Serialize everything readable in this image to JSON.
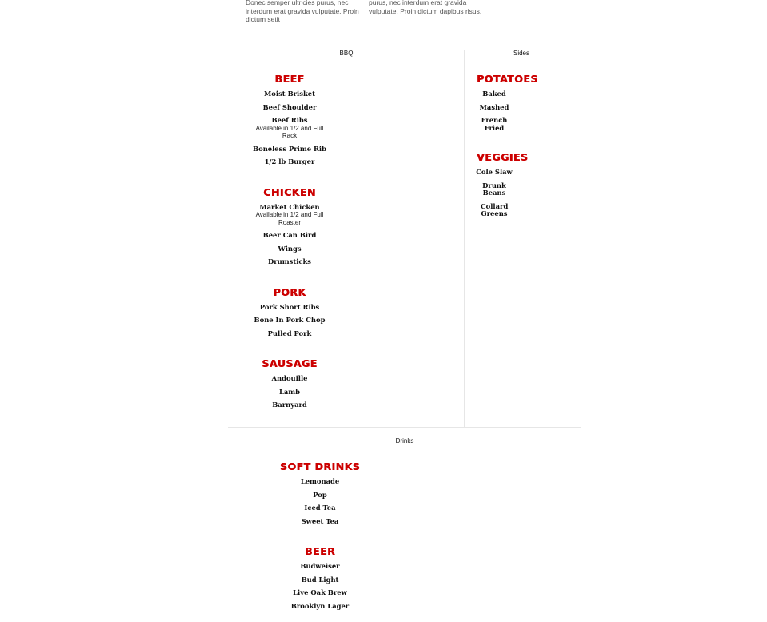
{
  "intro": {
    "left": "Donec semper ultricies purus, nec interdum erat gravida vulputate. Proin dictum setit",
    "right": "purus, nec interdum erat gravida vulputate. Proin dictum dapibus risus."
  },
  "sections": {
    "bbq": "BBQ",
    "sides": "Sides",
    "drinks": "Drinks"
  },
  "bbq": {
    "beef": {
      "title": "BEEF",
      "items": [
        {
          "name": "Moist Brisket"
        },
        {
          "name": "Beef Shoulder"
        },
        {
          "name": "Beef Ribs",
          "note": "Available in 1/2 and Full Rack"
        },
        {
          "name": "Boneless Prime Rib"
        },
        {
          "name": "1/2 lb Burger"
        }
      ]
    },
    "chicken": {
      "title": "CHICKEN",
      "items": [
        {
          "name": "Market Chicken",
          "note": "Available in 1/2 and Full Roaster"
        },
        {
          "name": "Beer Can Bird"
        },
        {
          "name": "Wings"
        },
        {
          "name": "Drumsticks"
        }
      ]
    },
    "pork": {
      "title": "PORK",
      "items": [
        {
          "name": "Pork Short Ribs"
        },
        {
          "name": "Bone In Pork Chop"
        },
        {
          "name": "Pulled Pork"
        }
      ]
    },
    "sausage": {
      "title": "SAUSAGE",
      "items": [
        {
          "name": "Andouille"
        },
        {
          "name": "Lamb"
        },
        {
          "name": "Barnyard"
        }
      ]
    }
  },
  "sides": {
    "potatoes": {
      "title": "POTATOES",
      "items": [
        {
          "name": "Baked"
        },
        {
          "name": "Mashed"
        },
        {
          "name": "French Fried"
        }
      ]
    },
    "veggies": {
      "title": "VEGGIES",
      "items": [
        {
          "name": "Cole Slaw"
        },
        {
          "name": "Drunk Beans"
        },
        {
          "name": "Collard Greens"
        }
      ]
    }
  },
  "drinks": {
    "soft": {
      "title": "SOFT DRINKS",
      "items": [
        {
          "name": "Lemonade"
        },
        {
          "name": "Pop"
        },
        {
          "name": "Iced Tea"
        },
        {
          "name": "Sweet Tea"
        }
      ]
    },
    "beer": {
      "title": "BEER",
      "items": [
        {
          "name": "Budweiser"
        },
        {
          "name": "Bud Light"
        },
        {
          "name": "Live Oak Brew"
        },
        {
          "name": "Brooklyn Lager"
        }
      ]
    }
  }
}
